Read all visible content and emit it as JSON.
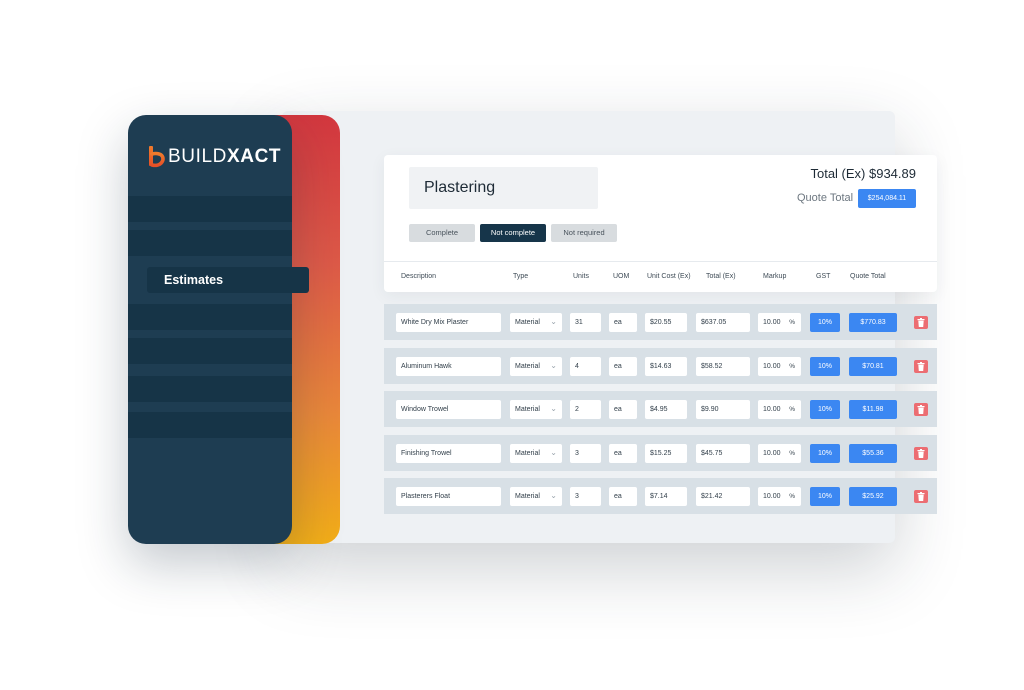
{
  "colors": {
    "brand_navy": "#1e3d52",
    "accent_blue": "#3b87f2",
    "delete_red": "#ec6d72",
    "gradient_top": "#d2373f",
    "gradient_bottom": "#f2ae18"
  },
  "brand": {
    "logo_icon": "buildxact-b-icon",
    "name_light": "BUILD",
    "name_bold": "XACT"
  },
  "sidebar": {
    "active_item": "Estimates"
  },
  "estimate": {
    "title": "Plastering",
    "total_ex": "Total (Ex) $934.89",
    "quote_total_label": "Quote Total",
    "quote_total_value": "$254,084.11"
  },
  "status_buttons": {
    "complete": "Complete",
    "not_complete": "Not complete",
    "not_required": "Not required",
    "selected": "Not complete"
  },
  "columns": {
    "description": "Description",
    "type": "Type",
    "units": "Units",
    "uom": "UOM",
    "unit_cost": "Unit Cost (Ex)",
    "total": "Total (Ex)",
    "markup": "Markup",
    "gst": "GST",
    "quote_total": "Quote Total"
  },
  "rows": [
    {
      "description": "White Dry Mix Plaster",
      "type": "Material",
      "units": "31",
      "uom": "ea",
      "unit_cost": "$20.55",
      "total": "$637.05",
      "markup": "10.00",
      "markup_unit": "%",
      "gst": "10%",
      "quote_total": "$770.83",
      "delete_icon": "trash-icon"
    },
    {
      "description": "Aluminum Hawk",
      "type": "Material",
      "units": "4",
      "uom": "ea",
      "unit_cost": "$14.63",
      "total": "$58.52",
      "markup": "10.00",
      "markup_unit": "%",
      "gst": "10%",
      "quote_total": "$70.81",
      "delete_icon": "trash-icon"
    },
    {
      "description": "Window Trowel",
      "type": "Material",
      "units": "2",
      "uom": "ea",
      "unit_cost": "$4.95",
      "total": "$9.90",
      "markup": "10.00",
      "markup_unit": "%",
      "gst": "10%",
      "quote_total": "$11.98",
      "delete_icon": "trash-icon"
    },
    {
      "description": "Finishing Trowel",
      "type": "Material",
      "units": "3",
      "uom": "ea",
      "unit_cost": "$15.25",
      "total": "$45.75",
      "markup": "10.00",
      "markup_unit": "%",
      "gst": "10%",
      "quote_total": "$55.36",
      "delete_icon": "trash-icon"
    },
    {
      "description": "Plasterers Float",
      "type": "Material",
      "units": "3",
      "uom": "ea",
      "unit_cost": "$7.14",
      "total": "$21.42",
      "markup": "10.00",
      "markup_unit": "%",
      "gst": "10%",
      "quote_total": "$25.92",
      "delete_icon": "trash-icon"
    }
  ]
}
